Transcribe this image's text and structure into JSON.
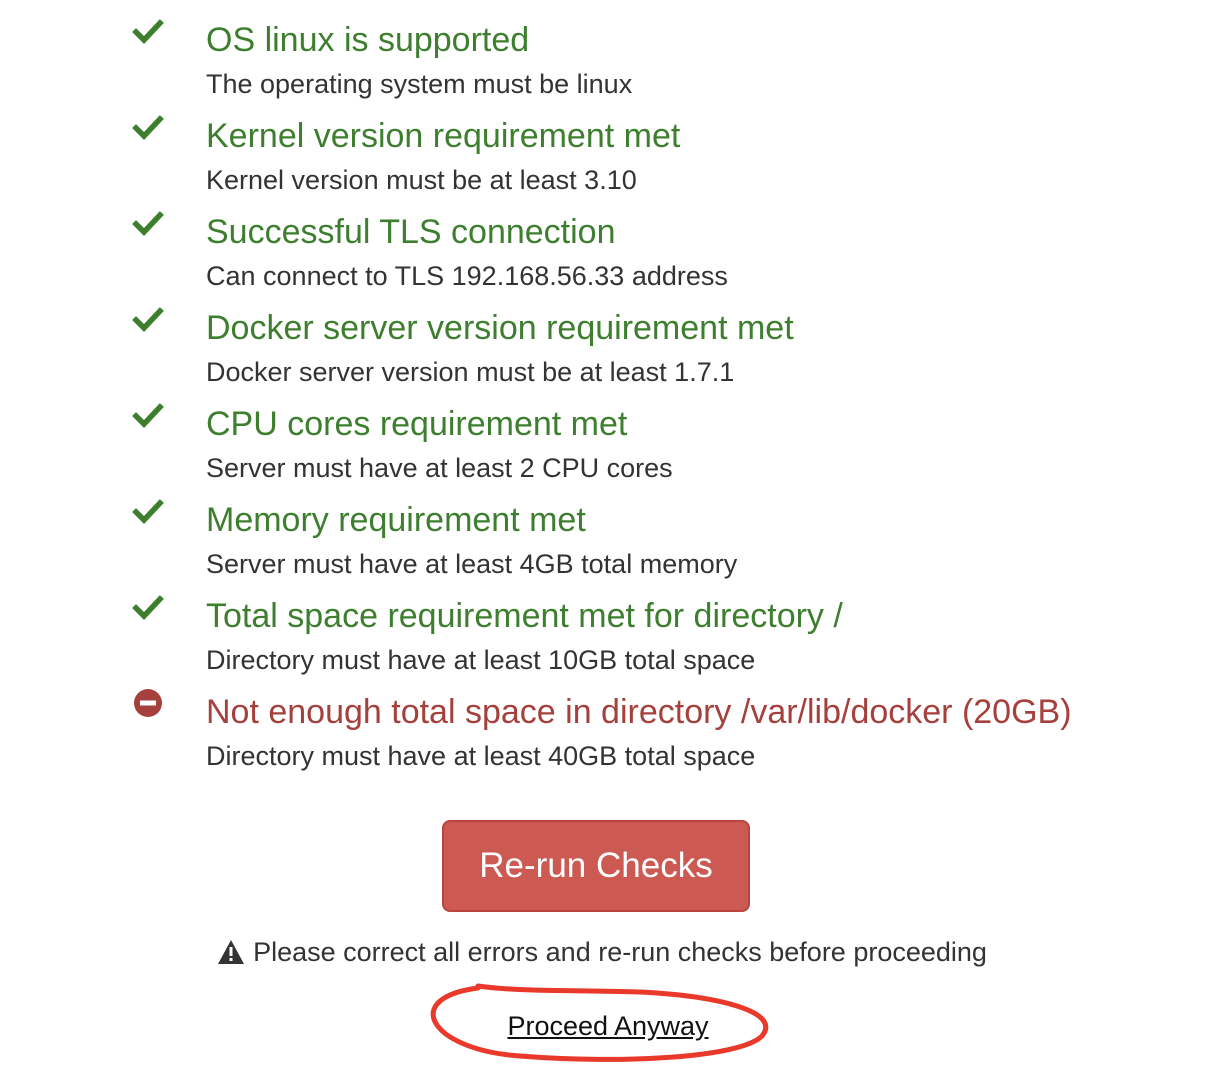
{
  "checks": [
    {
      "status": "pass",
      "icon": "check-icon",
      "title": "OS linux is supported",
      "detail": "The operating system must be linux"
    },
    {
      "status": "pass",
      "icon": "check-icon",
      "title": "Kernel version requirement met",
      "detail": "Kernel version must be at least 3.10"
    },
    {
      "status": "pass",
      "icon": "check-icon",
      "title": "Successful TLS connection",
      "detail": "Can connect to TLS 192.168.56.33 address"
    },
    {
      "status": "pass",
      "icon": "check-icon",
      "title": "Docker server version requirement met",
      "detail": "Docker server version must be at least 1.7.1"
    },
    {
      "status": "pass",
      "icon": "check-icon",
      "title": "CPU cores requirement met",
      "detail": "Server must have at least 2 CPU cores"
    },
    {
      "status": "pass",
      "icon": "check-icon",
      "title": "Memory requirement met",
      "detail": "Server must have at least 4GB total memory"
    },
    {
      "status": "pass",
      "icon": "check-icon",
      "title": "Total space requirement met for directory /",
      "detail": "Directory must have at least 10GB total space"
    },
    {
      "status": "fail",
      "icon": "minus-circle-icon",
      "title": "Not enough total space in directory /var/lib/docker (20GB)",
      "detail": "Directory must have at least 40GB total space"
    }
  ],
  "actions": {
    "rerun_label": "Re-run Checks",
    "warning_icon": "warning-triangle-icon",
    "warning_text": "Please correct all errors and re-run checks before proceeding",
    "proceed_label": "Proceed Anyway"
  },
  "colors": {
    "pass": "#3d7f2e",
    "fail": "#a6403c",
    "button": "#cc5a53",
    "annotation": "#e8392b"
  }
}
